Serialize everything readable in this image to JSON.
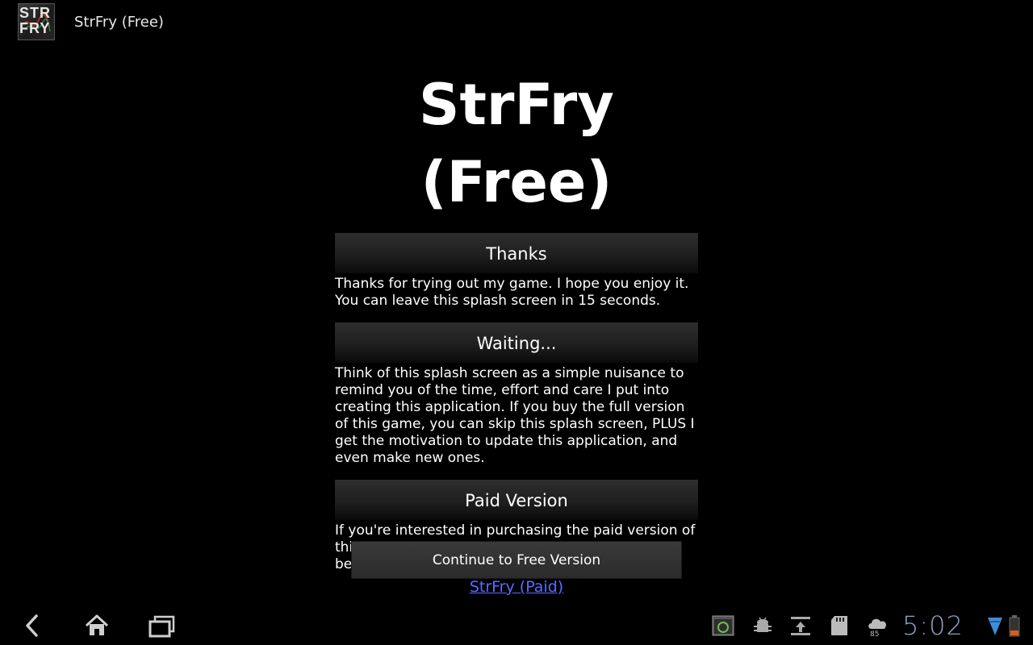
{
  "action_bar": {
    "app_title": "StrFry (Free)",
    "app_icon": {
      "name": "strfry-app-icon",
      "text_line1": "STR",
      "text_line2": "FRY"
    }
  },
  "main": {
    "title": "StrFry (Free)",
    "sections": [
      {
        "header": "Thanks",
        "body": "Thanks for trying out my game. I hope you enjoy it. You can leave this splash screen in 15 seconds."
      },
      {
        "header": "Waiting...",
        "body": "Think of this splash screen as a simple nuisance to remind you of the time, effort and care I put into creating this application. If you buy the full version of this game, you can skip this splash screen, PLUS I get the motivation to update this application, and even make new ones."
      },
      {
        "header": "Paid Version",
        "body": "If you're interested in purchasing the paid version of this game to support my efforts, you can click below. Thank you again. -Fisher Evans"
      }
    ],
    "paid_link": "StrFry (Paid)",
    "continue_button": "Continue to Free Version"
  },
  "system_bar": {
    "nav": [
      "back-icon",
      "home-icon",
      "recent-apps-icon"
    ],
    "status_icons": [
      "screenshot-icon",
      "android-debug-icon",
      "download-icon",
      "sd-card-icon",
      "weather-icon"
    ],
    "temperature": "85",
    "clock": "5:02",
    "connectivity_icons": [
      "wifi-icon",
      "battery-icon"
    ]
  },
  "colors": {
    "background": "#000000",
    "link": "#5b6bff",
    "clock": "#8aa4c8",
    "section_header": "#2e2e2e",
    "button": "#333333"
  }
}
